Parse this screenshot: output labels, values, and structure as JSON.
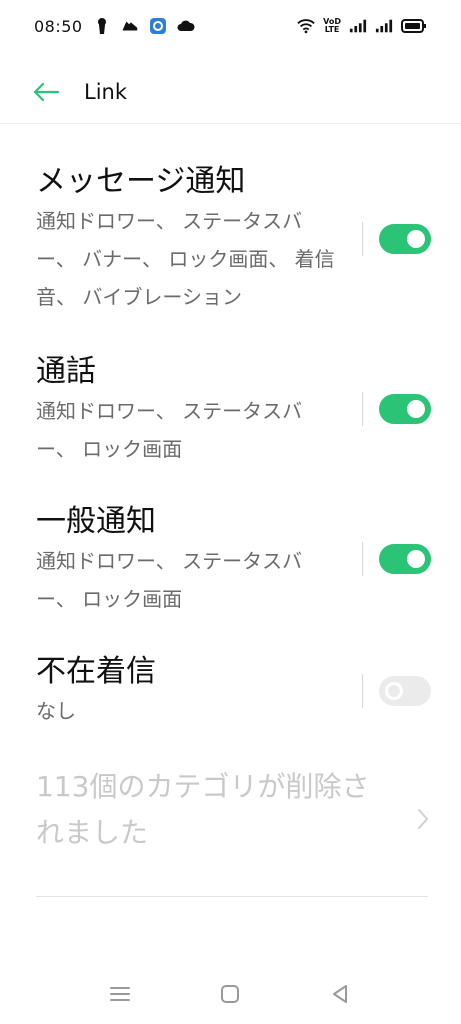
{
  "status_bar": {
    "time": "08:50",
    "volte_top": "VoD",
    "volte_bottom": "LTE"
  },
  "header": {
    "title": "Link"
  },
  "sections": [
    {
      "title": "メッセージ通知",
      "subtitle": "通知ドロワー、 ステータスバー、 バナー、 ロック画面、 着信音、 バイブレーション",
      "toggle_on": true
    },
    {
      "title": "通話",
      "subtitle": "通知ドロワー、 ステータスバー、 ロック画面",
      "toggle_on": true
    },
    {
      "title": "一般通知",
      "subtitle": "通知ドロワー、 ステータスバー、 ロック画面",
      "toggle_on": true
    },
    {
      "title": "不在着信",
      "subtitle": "なし",
      "toggle_on": false
    }
  ],
  "deleted_categories": {
    "label": "113個のカテゴリが削除されました"
  },
  "colors": {
    "accent": "#2bc476",
    "toggle_off": "#ebebeb",
    "secondary_text": "#6b6b6b",
    "disabled_text": "#c9c9c9"
  }
}
